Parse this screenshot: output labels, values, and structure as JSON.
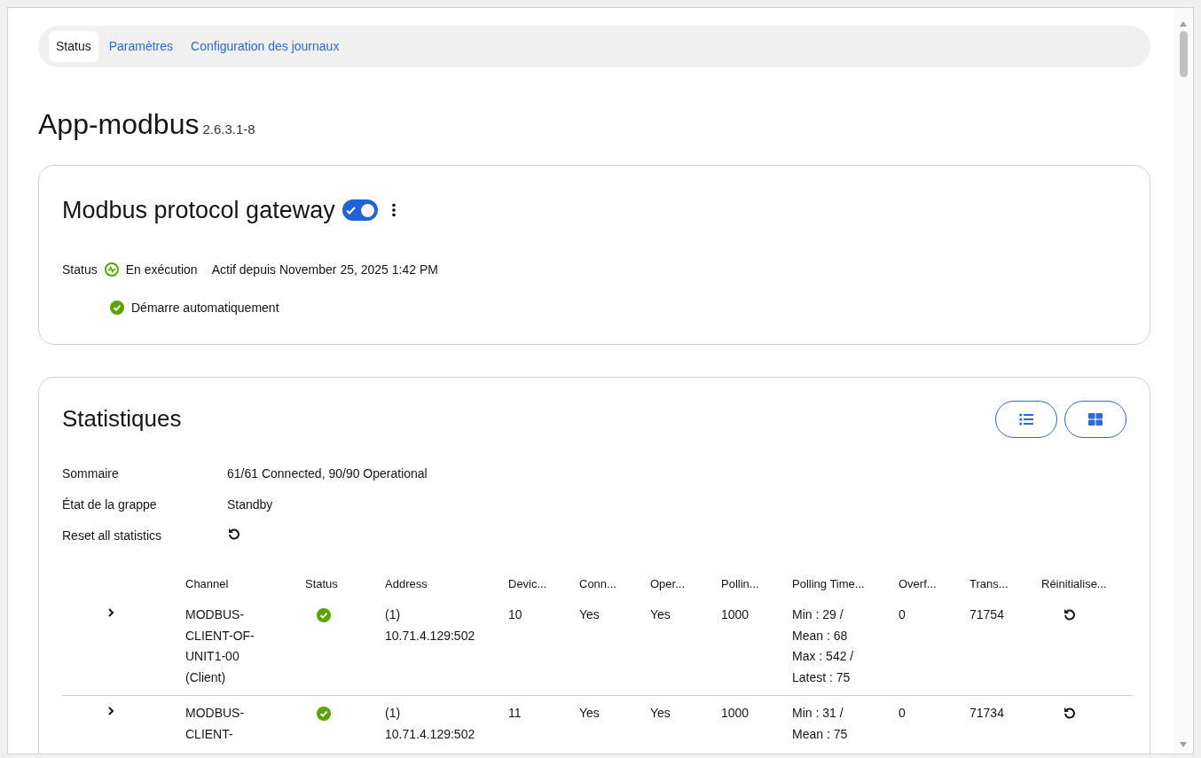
{
  "tabs": [
    {
      "label": "Status",
      "selected": true
    },
    {
      "label": "Paramètres",
      "selected": false
    },
    {
      "label": "Configuration des journaux",
      "selected": false
    }
  ],
  "app": {
    "title": "App-modbus",
    "version": "2.6.3.1-8"
  },
  "service": {
    "title": "Modbus protocol gateway",
    "enabled": true,
    "status_label": "Status",
    "status": "En exécution",
    "since": "Actif depuis November 25, 2025 1:42 PM",
    "autostart_on": true,
    "autostart": "Démarre automatiquement"
  },
  "statistics": {
    "title": "Statistiques",
    "summary": [
      {
        "label": "Sommaire",
        "value": "61/61 Connected, 90/90 Operational"
      },
      {
        "label": "État de la grappe",
        "value": "Standby"
      },
      {
        "label": "Reset all statistics",
        "kind": "reset"
      }
    ],
    "table": {
      "columns": [
        "Channel",
        "Status",
        "Address",
        "Devic...",
        "Conn...",
        "Oper...",
        "Pollin...",
        "Polling Time...",
        "Overf...",
        "Trans...",
        "Réinitialise..."
      ],
      "rows": [
        {
          "expanded": false,
          "channel": "MODBUS-CLIENT-OF-UNIT1-00 (Client)",
          "ok": true,
          "address": "(1) 10.71.4.129:502",
          "devices": "10",
          "connected": "Yes",
          "operational": "Yes",
          "polling": "1000",
          "polling_time": [
            "Min : 29 / Mean : 68",
            "Max : 542 / Latest : 75"
          ],
          "overflow": "0",
          "transactions": "71754"
        },
        {
          "expanded": false,
          "channel": "MODBUS-CLIENT-",
          "ok": true,
          "address": "(1) 10.71.4.129:502",
          "devices": "11",
          "connected": "Yes",
          "operational": "Yes",
          "polling": "1000",
          "polling_time": [
            "Min : 31 / Mean : 75"
          ],
          "overflow": "0",
          "transactions": "71734"
        }
      ]
    }
  }
}
